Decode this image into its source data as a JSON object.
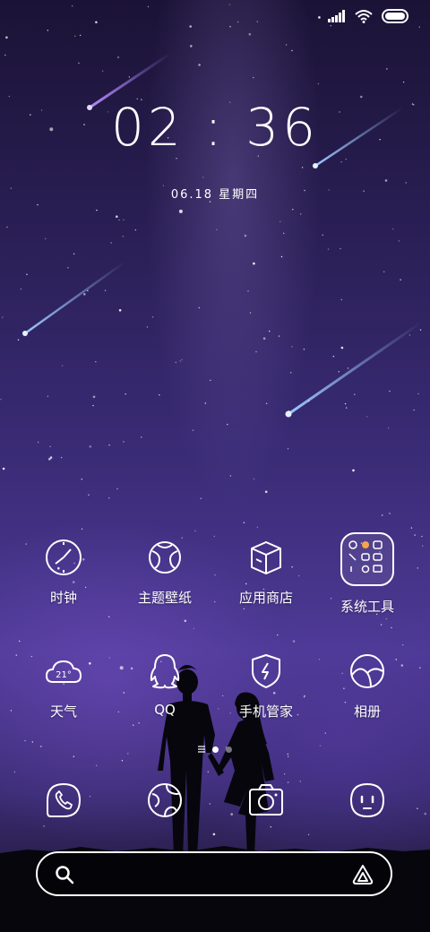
{
  "status_bar": {
    "icons": [
      "signal-icon",
      "wifi-icon",
      "battery-icon"
    ]
  },
  "lockclock": {
    "hour": "02",
    "sep": ":",
    "minute": "36",
    "date": "06.18 星期四"
  },
  "apps_row1": [
    {
      "label": "时钟",
      "icon": "clock-icon"
    },
    {
      "label": "主题壁纸",
      "icon": "theme-icon"
    },
    {
      "label": "应用商店",
      "icon": "store-icon"
    },
    {
      "label": "系统工具",
      "icon": "system-tools-folder-icon"
    }
  ],
  "apps_row2": [
    {
      "label": "天气",
      "icon": "weather-icon",
      "temp": "21°"
    },
    {
      "label": "QQ",
      "icon": "qq-icon"
    },
    {
      "label": "手机管家",
      "icon": "security-icon"
    },
    {
      "label": "相册",
      "icon": "gallery-icon"
    }
  ],
  "dock": [
    {
      "icon": "phone-icon"
    },
    {
      "icon": "browser-icon"
    },
    {
      "icon": "camera-icon"
    },
    {
      "icon": "messages-icon"
    }
  ],
  "search": {
    "icon": "search-icon",
    "assistant_icon": "assistant-icon"
  },
  "colors": {
    "bg_top": "#1b1336",
    "bg_mid": "#4d3a95",
    "accent": "#ffffff"
  }
}
